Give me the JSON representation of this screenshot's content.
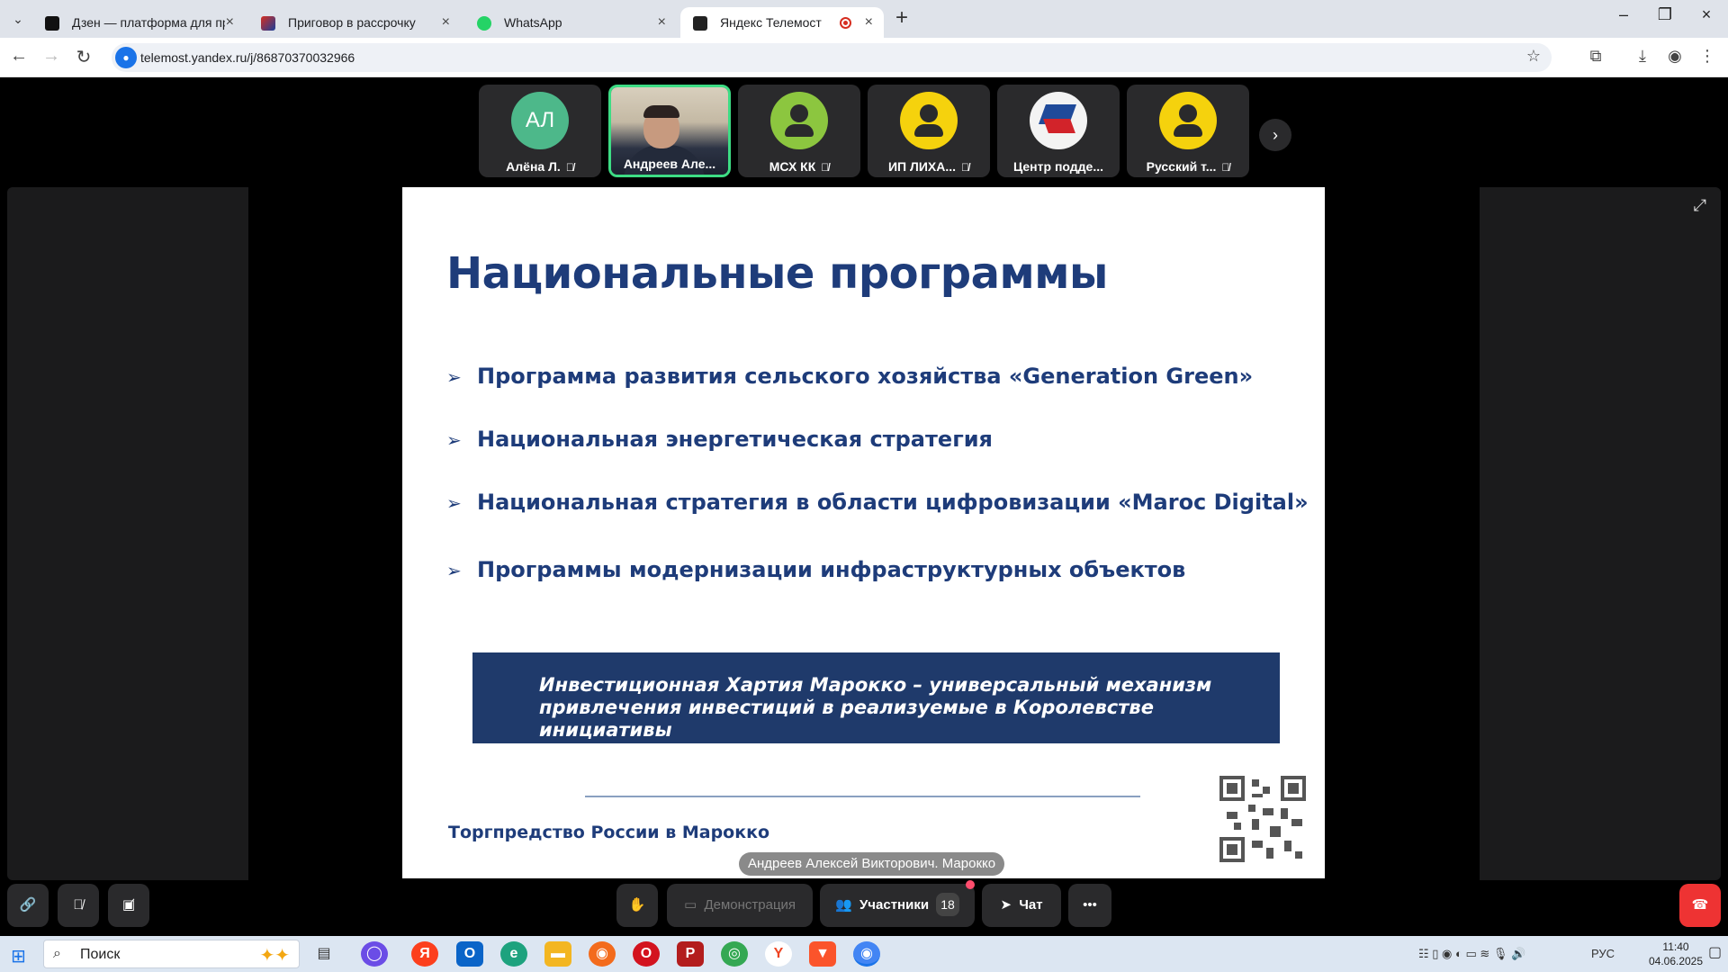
{
  "browser": {
    "tabs": [
      {
        "title": "Дзен — платформа для просм",
        "active": false
      },
      {
        "title": "Приговор в рассрочку",
        "active": false
      },
      {
        "title": "WhatsApp",
        "active": false
      },
      {
        "title": "Яндекс Телемост",
        "active": true
      }
    ],
    "url": "telemost.yandex.ru/j/86870370032966",
    "newtab": "+",
    "close": "×",
    "minimize": "–",
    "restore": "❐"
  },
  "participants": [
    {
      "name": "Алёна Л.",
      "initials": "АЛ",
      "color": "#4db88a",
      "muted": true
    },
    {
      "name": "Андреев Але...",
      "initials": "",
      "color": "",
      "muted": false
    },
    {
      "name": "МСХ КК",
      "initials": "",
      "color": "#8cc63f",
      "muted": true
    },
    {
      "name": "ИП ЛИХА...",
      "initials": "",
      "color": "#f5d20d",
      "muted": true
    },
    {
      "name": "Центр подде...",
      "initials": "",
      "color": "",
      "muted": false
    },
    {
      "name": "Русский т...",
      "initials": "",
      "color": "#f5d20d",
      "muted": true
    }
  ],
  "slide": {
    "title": "Национальные программы",
    "bullets": [
      "Программа развития сельского хозяйства «Generation Green»",
      "Национальная энергетическая стратегия",
      "Национальная стратегия в области цифровизации «Maroc Digital»",
      "Программы модернизации инфраструктурных объектов"
    ],
    "banner_line1": "Инвестиционная Хартия Марокко – универсальный механизм",
    "banner_line2": "привлечения инвестиций в реализуемые в Королевстве инициативы",
    "footer": "Торгпредство России в Марокко"
  },
  "caption": "Андреев Алексей Викторович. Марокко",
  "toolbar": {
    "demo": "Демонстрация",
    "participants": "Участники",
    "participants_count": "18",
    "chat": "Чат"
  },
  "taskbar": {
    "search": "Поиск",
    "lang": "РУС",
    "time": "11:40",
    "date": "04.06.2025"
  }
}
